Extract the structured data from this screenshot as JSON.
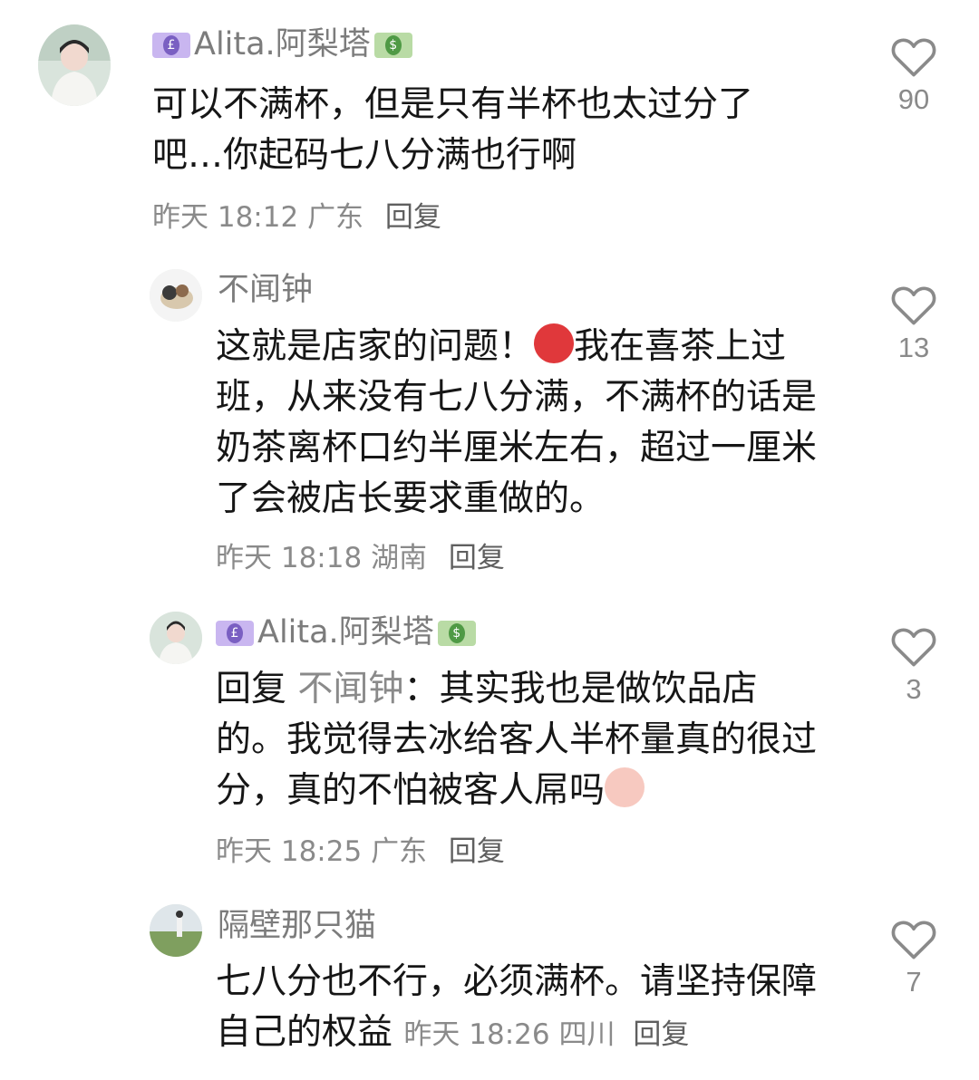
{
  "comments": [
    {
      "username": "Alita.阿梨塔",
      "text": "可以不满杯，但是只有半杯也太过分了吧…你起码七八分满也行啊",
      "time": "昨天 18:12",
      "location": "广东",
      "reply_label": "回复",
      "likes": "90"
    },
    {
      "username": "不闻钟",
      "text_before_emoji": "这就是店家的问题！",
      "emoji": "angry-face-emoji",
      "text_after_emoji": "我在喜茶上过班，从来没有七八分满，不满杯的话是奶茶离杯口约半厘米左右，超过一厘米了会被店长要求重做的。",
      "time": "昨天 18:18",
      "location": "湖南",
      "reply_label": "回复",
      "likes": "13"
    },
    {
      "username": "Alita.阿梨塔",
      "reply_prefix": "回复",
      "mention": "不闻钟",
      "text": "：其实我也是做饮品店的。我觉得去冰给客人半杯量真的很过分，真的不怕被客人屌吗",
      "emoji": "crying-face-emoji",
      "time": "昨天 18:25",
      "location": "广东",
      "reply_label": "回复",
      "likes": "3"
    },
    {
      "username": "隔壁那只猫",
      "text": "七八分也不行，必须满杯。请坚持保障自己的权益",
      "time": "昨天 18:26",
      "location": "四川",
      "reply_label": "回复",
      "likes": "7"
    }
  ],
  "icons": {
    "like": "heart-outline-icon",
    "badge": "money-bill-icon"
  }
}
